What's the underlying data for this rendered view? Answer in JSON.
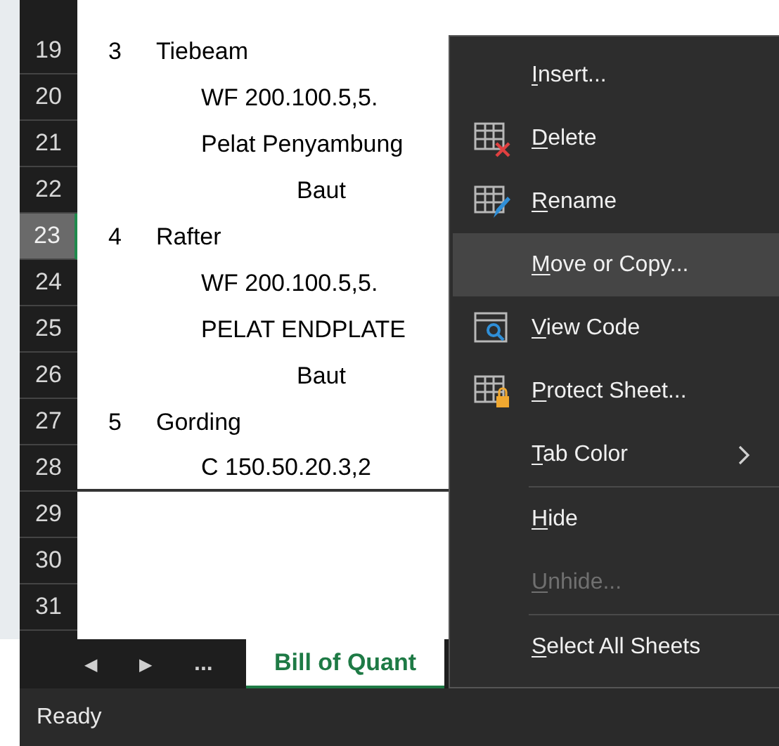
{
  "row_headers": [
    {
      "label": "19",
      "selected": false
    },
    {
      "label": "20",
      "selected": false
    },
    {
      "label": "21",
      "selected": false
    },
    {
      "label": "22",
      "selected": false
    },
    {
      "label": "23",
      "selected": true
    },
    {
      "label": "24",
      "selected": false
    },
    {
      "label": "25",
      "selected": false
    },
    {
      "label": "26",
      "selected": false
    },
    {
      "label": "27",
      "selected": false
    },
    {
      "label": "28",
      "selected": false
    },
    {
      "label": "29",
      "selected": false
    },
    {
      "label": "30",
      "selected": false
    },
    {
      "label": "31",
      "selected": false
    }
  ],
  "items": [
    {
      "number": "3",
      "name": "Tiebeam",
      "children": [
        {
          "name": "WF 200.100.5,5."
        },
        {
          "name": "Pelat Penyambung",
          "children": [
            {
              "name": "Baut"
            }
          ]
        }
      ]
    },
    {
      "number": "4",
      "name": "Rafter",
      "children": [
        {
          "name": "WF 200.100.5,5."
        },
        {
          "name": "PELAT ENDPLATE",
          "children": [
            {
              "name": "Baut"
            }
          ]
        }
      ]
    },
    {
      "number": "5",
      "name": "Gording",
      "children": [
        {
          "name": "C 150.50.20.3,2"
        }
      ]
    }
  ],
  "sheet_nav": {
    "previous": "◀",
    "next": "▶",
    "more": "..."
  },
  "sheet_tabs": [
    {
      "label": "Bill of Quant",
      "selected": true
    }
  ],
  "status_bar": "Ready",
  "context_menu": [
    {
      "kind": "plain",
      "label": "Insert...",
      "selected": false,
      "disabled": false
    },
    {
      "kind": "delete",
      "label": "Delete",
      "selected": false,
      "disabled": false
    },
    {
      "kind": "rename",
      "label": "Rename",
      "selected": false,
      "disabled": false
    },
    {
      "kind": "plain",
      "label": "Move or Copy...",
      "selected": true,
      "disabled": false
    },
    {
      "kind": "viewcode",
      "label": "View Code",
      "selected": false,
      "disabled": false
    },
    {
      "kind": "protect",
      "label": "Protect Sheet...",
      "selected": false,
      "disabled": false
    },
    {
      "kind": "submenu",
      "label": "Tab Color",
      "selected": false,
      "disabled": false
    },
    {
      "kind": "separator"
    },
    {
      "kind": "plain",
      "label": "Hide",
      "selected": false,
      "disabled": false
    },
    {
      "kind": "plain",
      "label": "Unhide...",
      "selected": false,
      "disabled": true
    },
    {
      "kind": "separator"
    },
    {
      "kind": "plain",
      "label": "Select All Sheets",
      "selected": false,
      "disabled": false
    }
  ]
}
